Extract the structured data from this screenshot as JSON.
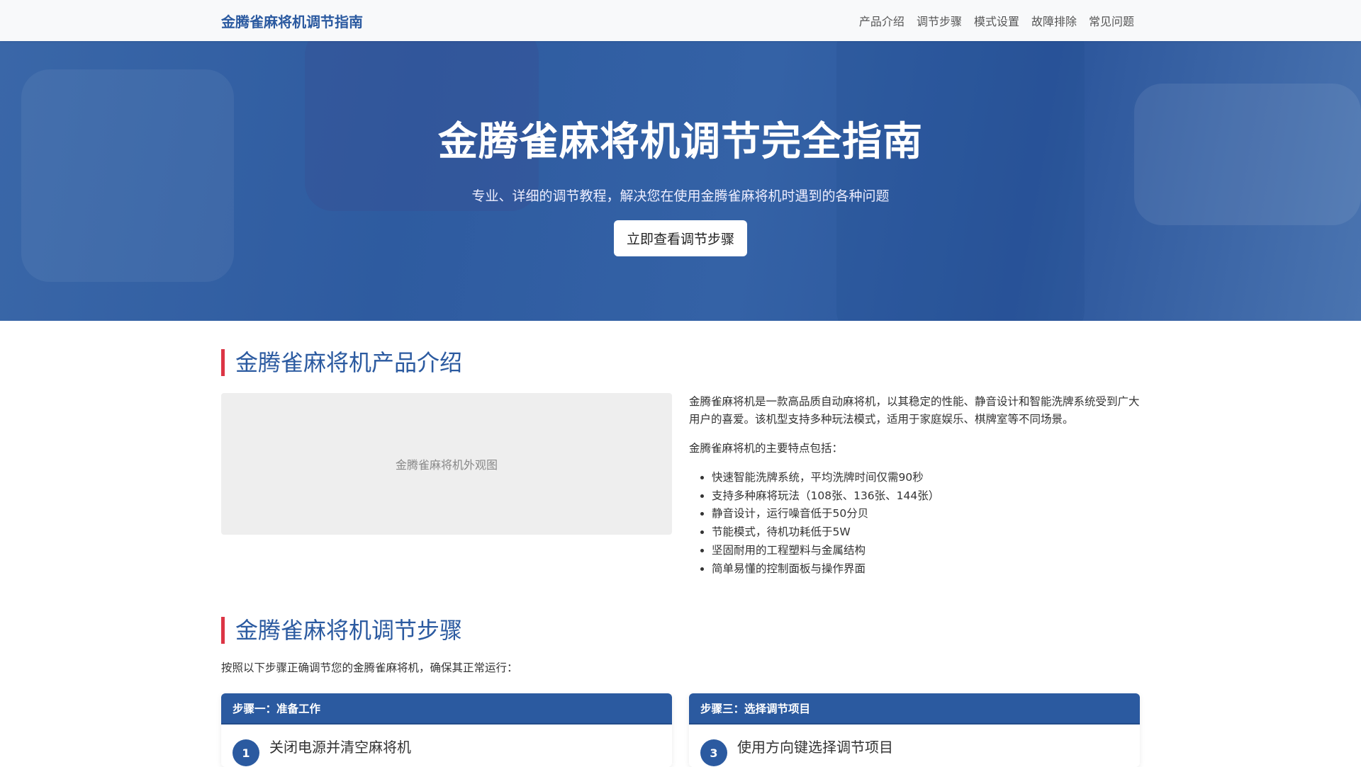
{
  "nav": {
    "brand": "金腾雀麻将机调节指南",
    "links": [
      "产品介绍",
      "调节步骤",
      "模式设置",
      "故障排除",
      "常见问题"
    ]
  },
  "hero": {
    "title": "金腾雀麻将机调节完全指南",
    "subtitle": "专业、详细的调节教程，解决您在使用金腾雀麻将机时遇到的各种问题",
    "button": "立即查看调节步骤"
  },
  "intro_section": {
    "title": "金腾雀麻将机产品介绍",
    "image_alt": "金腾雀麻将机外观图",
    "paragraph": "金腾雀麻将机是一款高品质自动麻将机，以其稳定的性能、静音设计和智能洗牌系统受到广大用户的喜爱。该机型支持多种玩法模式，适用于家庭娱乐、棋牌室等不同场景。",
    "features_label": "金腾雀麻将机的主要特点包括：",
    "features": [
      "快速智能洗牌系统，平均洗牌时间仅需90秒",
      "支持多种麻将玩法（108张、136张、144张）",
      "静音设计，运行噪音低于50分贝",
      "节能模式，待机功耗低于5W",
      "坚固耐用的工程塑料与金属结构",
      "简单易懂的控制面板与操作界面"
    ]
  },
  "steps_section": {
    "title": "金腾雀麻将机调节步骤",
    "intro": "按照以下步骤正确调节您的金腾雀麻将机，确保其正常运行：",
    "cards": [
      {
        "header": "步骤一：准备工作",
        "num": "1",
        "item": "关闭电源并清空麻将机"
      },
      {
        "header": "步骤三：选择调节项目",
        "num": "3",
        "item": "使用方向键选择调节项目"
      }
    ]
  }
}
